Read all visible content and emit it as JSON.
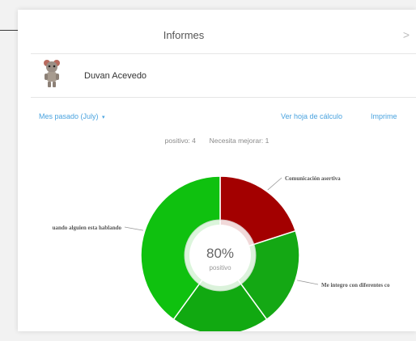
{
  "dialog": {
    "title": "Informes",
    "close_label": ">"
  },
  "user": {
    "name": "Duvan Acevedo"
  },
  "toolbar": {
    "month_label": "Mes pasado (July)",
    "month_caret": "▾",
    "spreadsheet_label": "Ver hoja de cálculo",
    "print_label": "Imprime"
  },
  "summary": {
    "positive_label": "positivo:",
    "positive_count": "4",
    "improve_label": "Necesita mejorar:",
    "improve_count": "1"
  },
  "chart_data": {
    "type": "pie",
    "center_value": "80%",
    "center_label": "positivo",
    "slices": [
      {
        "label": "Comunicación asertiva",
        "value": 1,
        "color": "#a30000"
      },
      {
        "label": "Me integro con diferentes co",
        "value": 1,
        "color": "#14a814"
      },
      {
        "label": "",
        "value": 1,
        "color": "#11a911"
      },
      {
        "label": "uando alguien esta hablando",
        "value": 2,
        "color": "#0fc10f"
      }
    ]
  }
}
